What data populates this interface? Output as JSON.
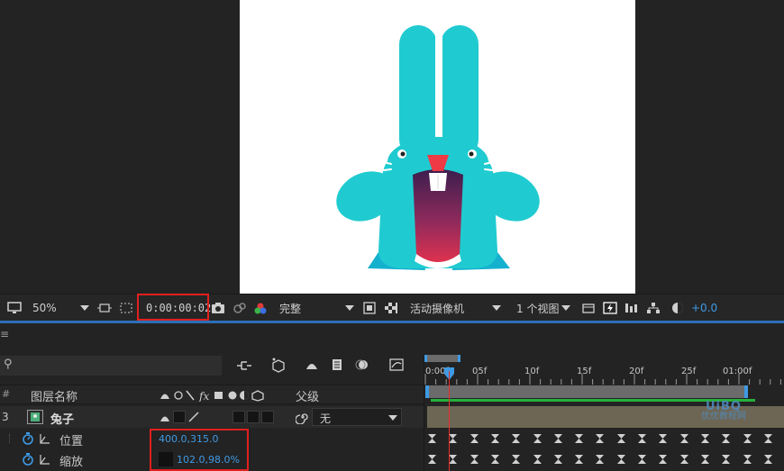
{
  "viewer": {
    "zoom": "50%",
    "timecode": "0:00:00:02",
    "resolution": "完整",
    "camera": "活动摄像机",
    "views": "1 个视图",
    "exposure": "+0.0"
  },
  "timeline": {
    "menu_icon": "≡",
    "search_icon_glyph": "⚲",
    "ruler": {
      "labels": [
        "0:00f",
        "05f",
        "10f",
        "15f",
        "20f",
        "25f",
        "01:00f"
      ]
    },
    "header": {
      "hash": "#",
      "layer_name": "图层名称",
      "parent": "父级"
    },
    "layer": {
      "index": "3",
      "name": "兔子",
      "parent_value": "无"
    },
    "properties": [
      {
        "name": "位置",
        "value": "400.0,315.0"
      },
      {
        "name": "缩放",
        "value": "102.0,98.0%"
      }
    ]
  },
  "watermark": {
    "line1": "UiBQ",
    "line2": "优优教程网"
  },
  "colors": {
    "highlight_box": "#e0201e",
    "accent_blue": "#3f9ae4",
    "bunny_teal": "#1fcbd0",
    "playhead": "#e8302c"
  }
}
